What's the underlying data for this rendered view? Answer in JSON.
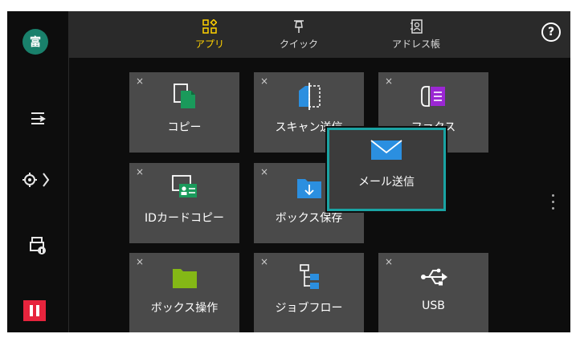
{
  "rail": {
    "avatar_label": "富"
  },
  "tabs": [
    {
      "label": "アプリ",
      "active": true
    },
    {
      "label": "クイック",
      "active": false
    },
    {
      "label": "アドレス帳",
      "active": false
    }
  ],
  "help_label": "?",
  "close_glyph": "×",
  "tiles": [
    {
      "label": "コピー",
      "icon": "copy-icon"
    },
    {
      "label": "スキャン送信",
      "icon": "scan-send-icon"
    },
    {
      "label": "ファクス",
      "icon": "fax-icon"
    },
    {
      "label": "IDカードコピー",
      "icon": "id-card-copy-icon"
    },
    {
      "label": "ボックス保存",
      "icon": "box-save-icon"
    },
    {
      "label": "ボックス操作",
      "icon": "box-operation-icon"
    },
    {
      "label": "ジョブフロー",
      "icon": "job-flow-icon"
    },
    {
      "label": "USB",
      "icon": "usb-icon"
    }
  ],
  "popup": {
    "label": "メール送信",
    "icon": "mail-icon"
  },
  "colors": {
    "accent_tab": "#ffd100",
    "tile_bg": "#4a4a4a",
    "popup_border": "#1aa3a3",
    "copy_green": "#1a9a5b",
    "scan_blue": "#2b8fe0",
    "fax_purple": "#9b27d3",
    "box_green": "#84b816",
    "pause_red": "#e7243d"
  }
}
